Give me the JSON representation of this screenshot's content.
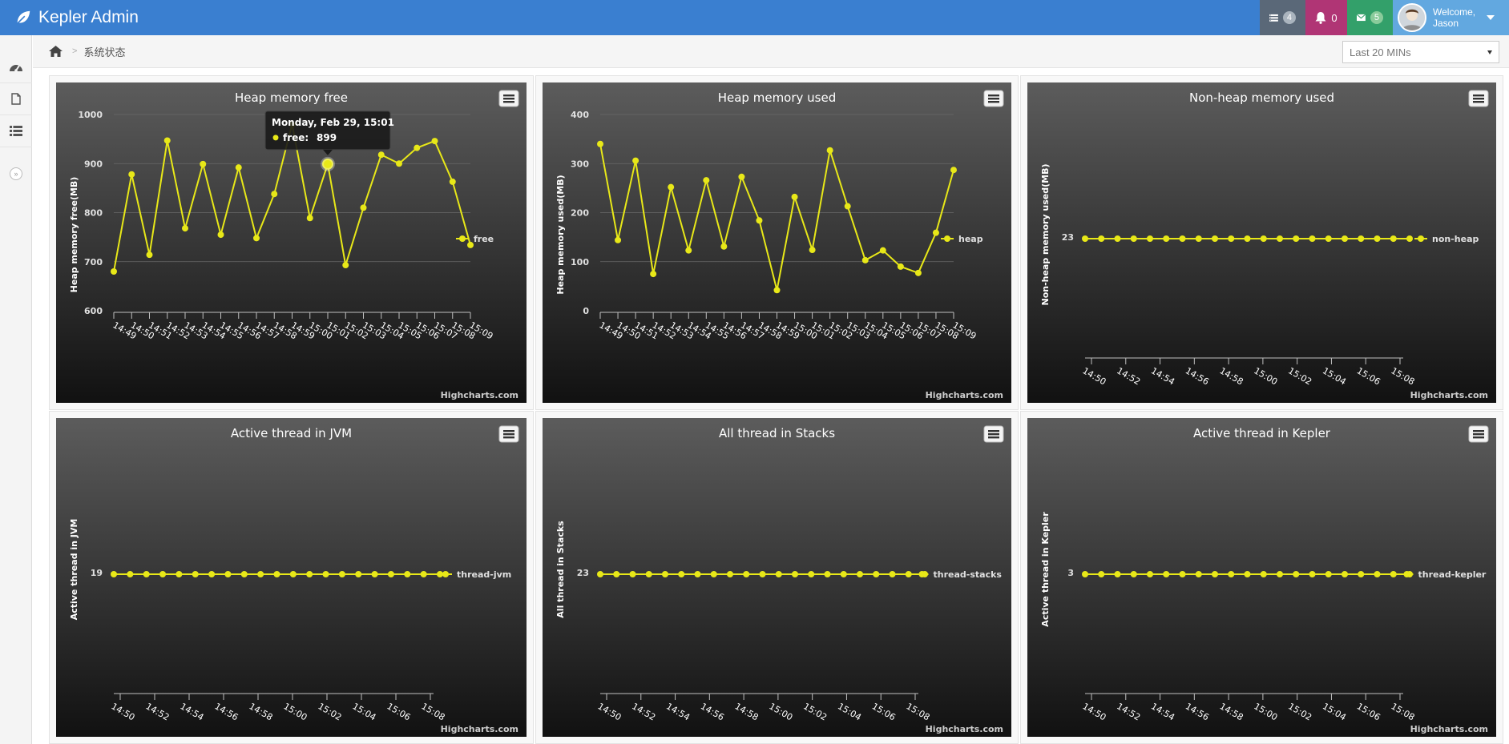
{
  "app": {
    "brand": "Kepler Admin",
    "notifications": {
      "tasks_count": "4",
      "alerts_count": "0",
      "messages_count": "5"
    },
    "user": {
      "welcome": "Welcome,",
      "name": "Jason"
    }
  },
  "breadcrumb": {
    "page": "系统状态"
  },
  "time_range": {
    "selected": "Last 20 MINs"
  },
  "sidebar": {
    "items": [
      "dashboard-icon",
      "file-icon",
      "list-icon"
    ],
    "toggle": "»"
  },
  "colors": {
    "accent": "#3a7fd0",
    "series": "#e8e818",
    "chart_bg_top": "#5c5c5c",
    "chart_bg_bottom": "#111111"
  },
  "charts": [
    {
      "title": "Heap memory free",
      "series_name": "free",
      "ylabel": "Heap memory free(MB)",
      "tooltip": {
        "date": "Monday, Feb 29, 15:01",
        "label": "free:",
        "value": "899",
        "point_index": 12
      }
    },
    {
      "title": "Heap memory used",
      "series_name": "heap",
      "ylabel": "Heap memory used(MB)"
    },
    {
      "title": "Non-heap memory used",
      "series_name": "non-heap",
      "ylabel": "Non-heap memory used(MB)"
    },
    {
      "title": "Active thread in JVM",
      "series_name": "thread-jvm",
      "ylabel": "Active thread in JVM"
    },
    {
      "title": "All thread in Stacks",
      "series_name": "thread-stacks",
      "ylabel": "All thread in Stacks"
    },
    {
      "title": "Active thread in Kepler",
      "series_name": "thread-kepler",
      "ylabel": "Active thread in Kepler"
    }
  ],
  "credits": "Highcharts.com",
  "chart_data": [
    {
      "type": "line",
      "title": "Heap memory free",
      "ylabel": "Heap memory free(MB)",
      "ylim": [
        600,
        1000
      ],
      "yticks": [
        "600",
        "700",
        "800",
        "900",
        "1000"
      ],
      "x": [
        "14:49",
        "14:50",
        "14:51",
        "14:52",
        "14:53",
        "14:54",
        "14:55",
        "14:56",
        "14:57",
        "14:58",
        "14:59",
        "15:00",
        "15:01",
        "15:02",
        "15:03",
        "15:04",
        "15:05",
        "15:06",
        "15:07",
        "15:08",
        "15:09"
      ],
      "series": [
        {
          "name": "free",
          "values": [
            680,
            878,
            714,
            947,
            768,
            899,
            755,
            892,
            748,
            838,
            980,
            789,
            899,
            693,
            810,
            918,
            900,
            932,
            946,
            863,
            734
          ]
        }
      ],
      "legend": "right"
    },
    {
      "type": "line",
      "title": "Heap memory used",
      "ylabel": "Heap memory used(MB)",
      "ylim": [
        0,
        400
      ],
      "yticks": [
        "0",
        "100",
        "200",
        "300",
        "400"
      ],
      "x": [
        "14:49",
        "14:50",
        "14:51",
        "14:52",
        "14:53",
        "14:54",
        "14:55",
        "14:56",
        "14:57",
        "14:58",
        "14:59",
        "15:00",
        "15:01",
        "15:02",
        "15:03",
        "15:04",
        "15:05",
        "15:06",
        "15:07",
        "15:08",
        "15:09"
      ],
      "series": [
        {
          "name": "heap",
          "values": [
            340,
            144,
            306,
            75,
            252,
            123,
            266,
            131,
            273,
            184,
            42,
            232,
            124,
            327,
            213,
            103,
            123,
            90,
            77,
            159,
            287
          ]
        }
      ],
      "legend": "right"
    },
    {
      "type": "line",
      "title": "Non-heap memory used",
      "ylabel": "Non-heap memory used(MB)",
      "yticks": [
        "23"
      ],
      "x": [
        "14:50",
        "14:52",
        "14:54",
        "14:56",
        "14:58",
        "15:00",
        "15:02",
        "15:04",
        "15:06",
        "15:08"
      ],
      "series": [
        {
          "name": "non-heap",
          "values": [
            23,
            23,
            23,
            23,
            23,
            23,
            23,
            23,
            23,
            23,
            23,
            23,
            23,
            23,
            23,
            23,
            23,
            23,
            23,
            23,
            23
          ]
        }
      ],
      "legend": "right"
    },
    {
      "type": "line",
      "title": "Active thread in JVM",
      "ylabel": "Active thread in JVM",
      "yticks": [
        "19"
      ],
      "x": [
        "14:50",
        "14:52",
        "14:54",
        "14:56",
        "14:58",
        "15:00",
        "15:02",
        "15:04",
        "15:06",
        "15:08"
      ],
      "series": [
        {
          "name": "thread-jvm",
          "values": [
            19,
            19,
            19,
            19,
            19,
            19,
            19,
            19,
            19,
            19,
            19,
            19,
            19,
            19,
            19,
            19,
            19,
            19,
            19,
            19,
            19
          ]
        }
      ],
      "legend": "right"
    },
    {
      "type": "line",
      "title": "All thread in Stacks",
      "ylabel": "All thread in Stacks",
      "yticks": [
        "23"
      ],
      "x": [
        "14:50",
        "14:52",
        "14:54",
        "14:56",
        "14:58",
        "15:00",
        "15:02",
        "15:04",
        "15:06",
        "15:08"
      ],
      "series": [
        {
          "name": "thread-stacks",
          "values": [
            23,
            23,
            23,
            23,
            23,
            23,
            23,
            23,
            23,
            23,
            23,
            23,
            23,
            23,
            23,
            23,
            23,
            23,
            23,
            23,
            23
          ]
        }
      ],
      "legend": "right"
    },
    {
      "type": "line",
      "title": "Active thread in Kepler",
      "ylabel": "Active thread in Kepler",
      "yticks": [
        "3"
      ],
      "x": [
        "14:50",
        "14:52",
        "14:54",
        "14:56",
        "14:58",
        "15:00",
        "15:02",
        "15:04",
        "15:06",
        "15:08"
      ],
      "series": [
        {
          "name": "thread-kepler",
          "values": [
            3,
            3,
            3,
            3,
            3,
            3,
            3,
            3,
            3,
            3,
            3,
            3,
            3,
            3,
            3,
            3,
            3,
            3,
            3,
            3,
            3
          ]
        }
      ],
      "legend": "right"
    }
  ]
}
